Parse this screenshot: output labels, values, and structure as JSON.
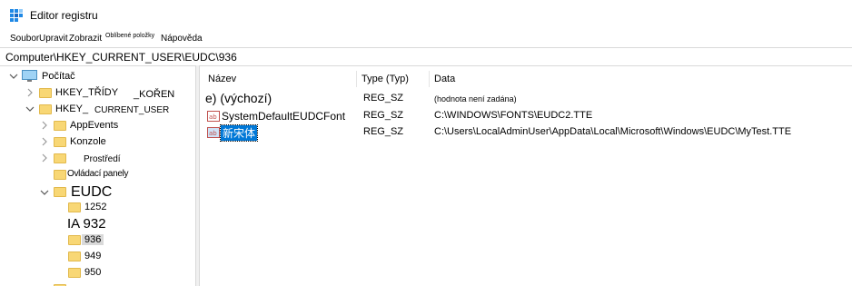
{
  "window": {
    "title": "Editor registru"
  },
  "menu": {
    "items": [
      "Soubor",
      "Upravit",
      "Zobrazit",
      "Oblíbené položky",
      "Nápověda"
    ]
  },
  "address": {
    "path": "Computer\\HKEY_CURRENT_USER\\EUDC\\936"
  },
  "tree": {
    "root": "Počítač",
    "hkcr": {
      "a": "HKEY_TŘÍDY",
      "b": "_KOŘEN"
    },
    "hkcu": {
      "a": "HKEY_",
      "b": "CURRENT_USER"
    },
    "appevents": "AppEvents",
    "konzole": "Konzole",
    "prostredi": "Prostředí",
    "ovladaci": "Ovládací panely",
    "eudc": "EUDC",
    "k1252": "1252",
    "ia932": "IA 932",
    "k936": "936",
    "k949": "949",
    "k950": "950"
  },
  "list": {
    "headers": {
      "name": "Název",
      "type": "Type (Typ)",
      "data": "Data"
    },
    "rows": [
      {
        "name": "e) (výchozí)",
        "type": "REG_SZ",
        "data": "(hodnota není zadána)"
      },
      {
        "name": "SystemDefaultEUDCFont",
        "type": "REG_SZ",
        "data": "C:\\WINDOWS\\FONTS\\EUDC2.TTE"
      },
      {
        "name": "新宋体",
        "type": "REG_SZ",
        "data": "C:\\Users\\LocalAdminUser\\AppData\\Local\\Microsoft\\Windows\\EUDC\\MyTest.TTE"
      }
    ]
  },
  "colors": {
    "selection": "#0078d7",
    "folder": "#f8d775",
    "tree_selected": "#d9d9d9"
  }
}
